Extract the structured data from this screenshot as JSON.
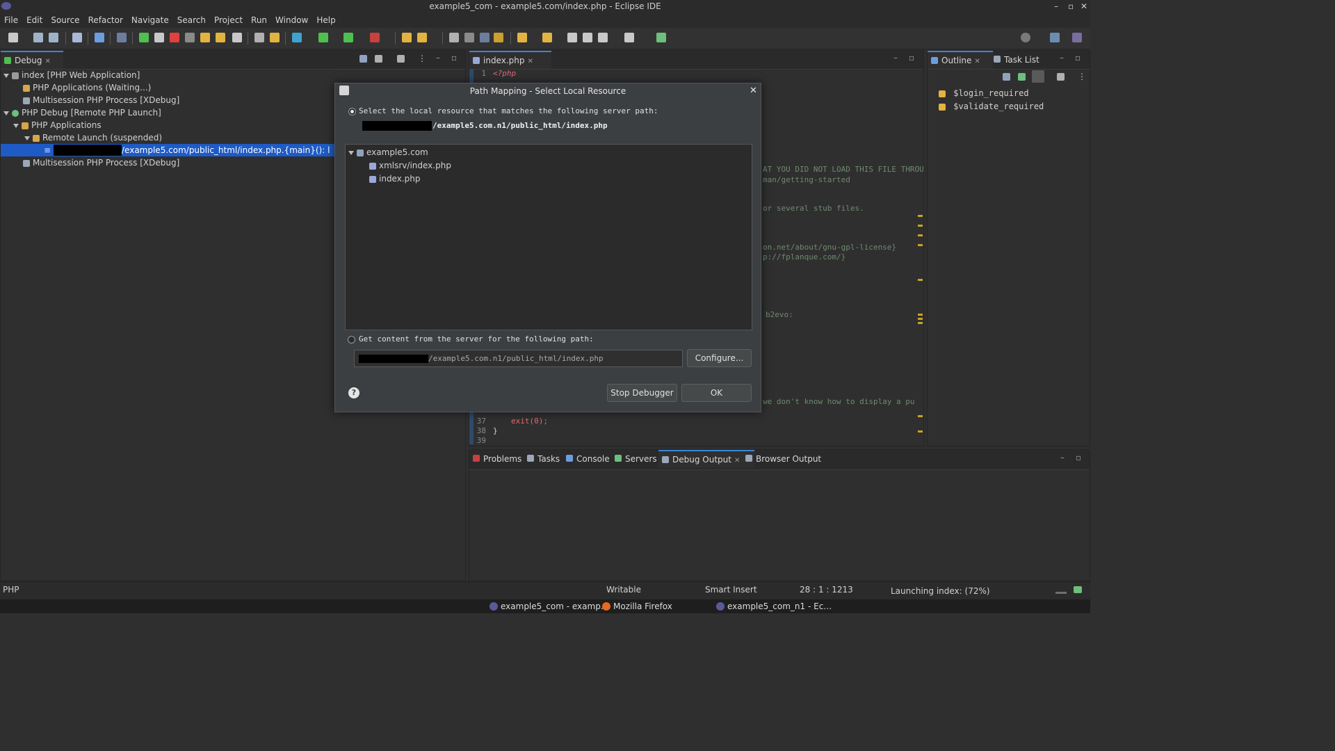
{
  "window": {
    "title": "example5_com - example5.com/index.php - Eclipse IDE",
    "controls": [
      "–",
      "▫",
      "✕"
    ]
  },
  "menu": [
    "File",
    "Edit",
    "Source",
    "Refactor",
    "Navigate",
    "Search",
    "Project",
    "Run",
    "Window",
    "Help"
  ],
  "debug_view": {
    "tab": "Debug",
    "tree": [
      {
        "label": "index [PHP Web Application]"
      },
      {
        "label": "PHP Applications (Waiting...)"
      },
      {
        "label": "Multisession PHP Process [XDebug]"
      },
      {
        "label": "PHP Debug [Remote PHP Launch]"
      },
      {
        "label": "PHP Applications"
      },
      {
        "label": "Remote Launch (suspended)"
      },
      {
        "label": "/example5.com/public_html/index.php.{main}(): l"
      },
      {
        "label": "Multisession PHP Process [XDebug]"
      }
    ]
  },
  "editor": {
    "tab": "index.php",
    "lines": [
      {
        "n": "1",
        "text": "<?php"
      },
      {
        "n": "37",
        "text": "exit(0);"
      },
      {
        "n": "38",
        "text": "}"
      },
      {
        "n": "39",
        "text": ""
      }
    ],
    "visible_fragments": [
      "AT YOU DID NOT LOAD THIS FILE THROU",
      "man/getting-started",
      "or several stub files.",
      "on.net/about/gnu-gpl-license}",
      "p://fplanque.com/}",
      "b2evo:",
      "we don't know how to display a pu"
    ]
  },
  "outline": {
    "tabs": [
      "Outline",
      "Task List"
    ],
    "items": [
      "$login_required",
      "$validate_required"
    ]
  },
  "bottom_tabs": [
    "Problems",
    "Tasks",
    "Console",
    "Servers",
    "Debug Output",
    "Browser Output"
  ],
  "dialog": {
    "title": "Path Mapping - Select Local Resource",
    "option1_label": "Select the local resource that matches the following server path:",
    "server_path": "/example5.com.n1/public_html/index.php",
    "tree": {
      "root": "example5.com",
      "children": [
        "xmlsrv/index.php",
        "index.php"
      ]
    },
    "option2_label": "Get content from the server for the following path:",
    "path_field_value": "/example5.com.n1/public_html/index.php",
    "configure_label": "Configure...",
    "stop_label": "Stop Debugger",
    "ok_label": "OK",
    "help": "?"
  },
  "status": {
    "left": "PHP",
    "writable": "Writable",
    "insert": "Smart Insert",
    "position": "28 : 1 : 1213",
    "progress": "Launching index: (72%)",
    "progress_value": 72
  },
  "taskbar": [
    {
      "label": "example5_com - examp…",
      "color": "#5a5a9a"
    },
    {
      "label": "Mozilla Firefox",
      "color": "#e66a1f"
    },
    {
      "label": "example5_com_n1 - Ec…",
      "color": "#5a5a9a"
    }
  ],
  "colors": {
    "selection": "#1e5bc6",
    "accent": "#3c88d6",
    "keyword": "#e06c75"
  }
}
